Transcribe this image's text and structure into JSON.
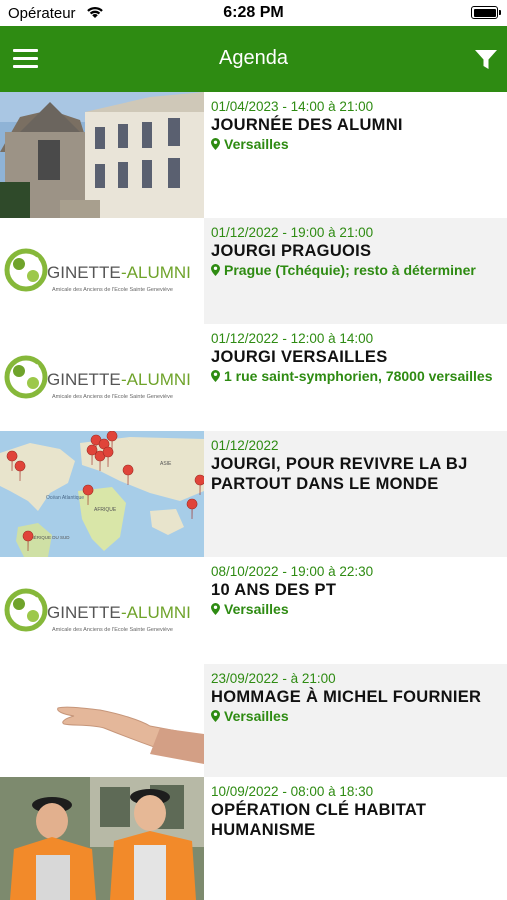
{
  "status_bar": {
    "carrier": "Opérateur",
    "time": "6:28 PM"
  },
  "nav": {
    "title": "Agenda"
  },
  "logo": {
    "name_left": "GINETTE",
    "name_right": "-ALUMNI",
    "tagline": "Amicale des Anciens de l'Ecole Sainte Geneviève"
  },
  "map_labels": {
    "ocean": "Océan Atlantique",
    "africa": "AFRIQUE",
    "asia": "ASIE",
    "south_america": "AMÉRIQUE DU SUD"
  },
  "events": [
    {
      "date": "01/04/2023 - 14:00 à 21:00",
      "title": "JOURNÉE DES ALUMNI",
      "location": "Versailles",
      "thumbnail": "building-photo"
    },
    {
      "date": "01/12/2022 - 19:00 à 21:00",
      "title": "JOURGI PRAGUOIS",
      "location": "Prague (Tchéquie); resto à déterminer",
      "thumbnail": "ginette-alumni-logo"
    },
    {
      "date": "01/12/2022 - 12:00 à 14:00",
      "title": "JOURGI VERSAILLES",
      "location": "1 rue saint-symphorien, 78000 versailles",
      "thumbnail": "ginette-alumni-logo"
    },
    {
      "date": "01/12/2022",
      "title": "JOURGI, POUR REVIVRE LA BJ PARTOUT DANS LE MONDE",
      "location": "",
      "thumbnail": "world-map-pins"
    },
    {
      "date": "08/10/2022 - 19:00 à 22:30",
      "title": "10 ANS DES PT",
      "location": "Versailles",
      "thumbnail": "ginette-alumni-logo"
    },
    {
      "date": "23/09/2022 - à 21:00",
      "title": "HOMMAGE À MICHEL FOURNIER",
      "location": "Versailles",
      "thumbnail": "open-hand-photo"
    },
    {
      "date": "10/09/2022 - 08:00 à 18:30",
      "title": "OPÉRATION CLÉ HABITAT HUMANISME",
      "location": "",
      "thumbnail": "volunteers-photo"
    }
  ],
  "colors": {
    "brand_green": "#2e8b12",
    "alt_row_bg": "#f2f2f2"
  }
}
